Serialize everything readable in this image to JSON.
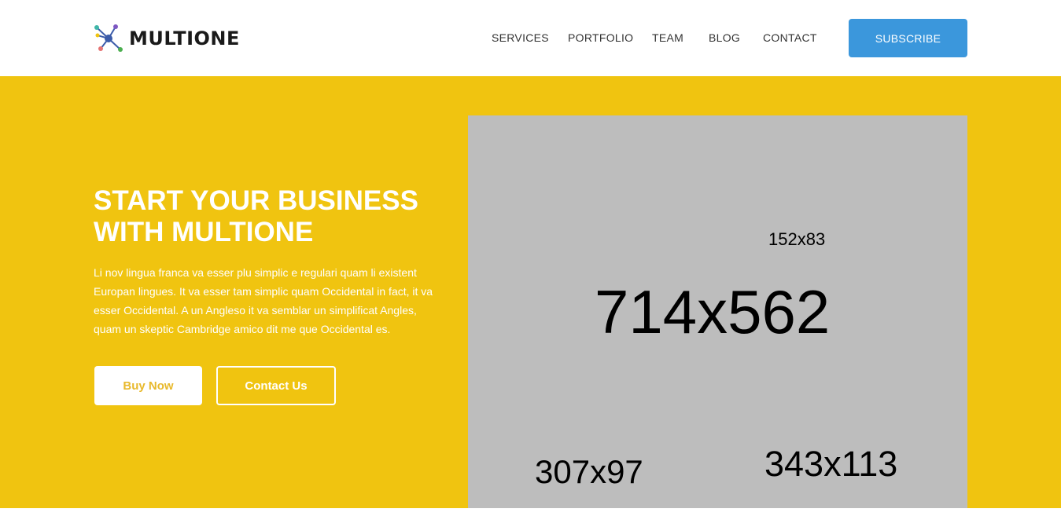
{
  "header": {
    "logo_text": "MULTIONE",
    "logo_icon": "molecule-icon",
    "nav": {
      "services": "SERVICES",
      "portfolio": "PORTFOLIO",
      "team": "TEAM",
      "blog": "BLOG",
      "contact": "CONTACT"
    },
    "subscribe_label": "SUBSCRIBE"
  },
  "hero": {
    "title_line1": "START YOUR BUSINESS",
    "title_line2": "WITH MULTIONE",
    "text": "Li nov lingua franca va esser plu simplic e regulari quam li existent Europan lingues. It va esser tam simplic quam Occidental in fact, it va esser Occidental. A un Angleso it va semblar un simplificat Angles, quam un skeptic Cambridge amico dit me que Occidental es.",
    "buy_label": "Buy Now",
    "contact_label": "Contact Us"
  },
  "placeholder": {
    "label_small": "152x83",
    "label_large": "714x562",
    "label_left": "307x97",
    "label_right": "343x113"
  },
  "colors": {
    "hero_bg": "#f0c410",
    "subscribe_bg": "#3b97dc",
    "buy_text": "#e8b92c",
    "placeholder_bg": "#bdbdbd"
  }
}
